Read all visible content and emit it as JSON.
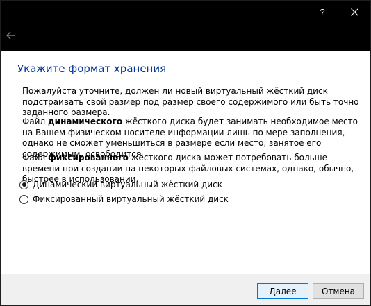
{
  "titlebar": {
    "help_label": "?",
    "close_icon": "close-icon"
  },
  "nav": {
    "back_icon": "back-arrow-icon"
  },
  "page": {
    "title": "Укажите формат хранения",
    "para1": "Пожалуйста уточните, должен ли новый виртуальный жёсткий диск подстраивать свой размер под размер своего содержимого или быть точно заданного размера.",
    "para2_prefix": "Файл ",
    "para2_bold": "динамического",
    "para2_suffix": " жёсткого диска будет занимать необходимое место на Вашем физическом носителе информации лишь по мере заполнения, однако не сможет уменьшиться в размере если место, занятое его содержимым, освободится.",
    "para3_prefix": "Файл ",
    "para3_bold": "фиксированного",
    "para3_suffix": " жёсткого диска может потребовать больше времени при создании на некоторых файловых системах, однако, обычно, быстрее в использовании."
  },
  "options": [
    {
      "label": "Динамический виртуальный жёсткий диск",
      "checked": true
    },
    {
      "label": "Фиксированный виртуальный жёсткий диск",
      "checked": false
    }
  ],
  "footer": {
    "next_label": "Далее",
    "cancel_label": "Отмена"
  },
  "colors": {
    "title": "#003399",
    "titlebar": "#000000",
    "footer": "#f0f0f0"
  }
}
